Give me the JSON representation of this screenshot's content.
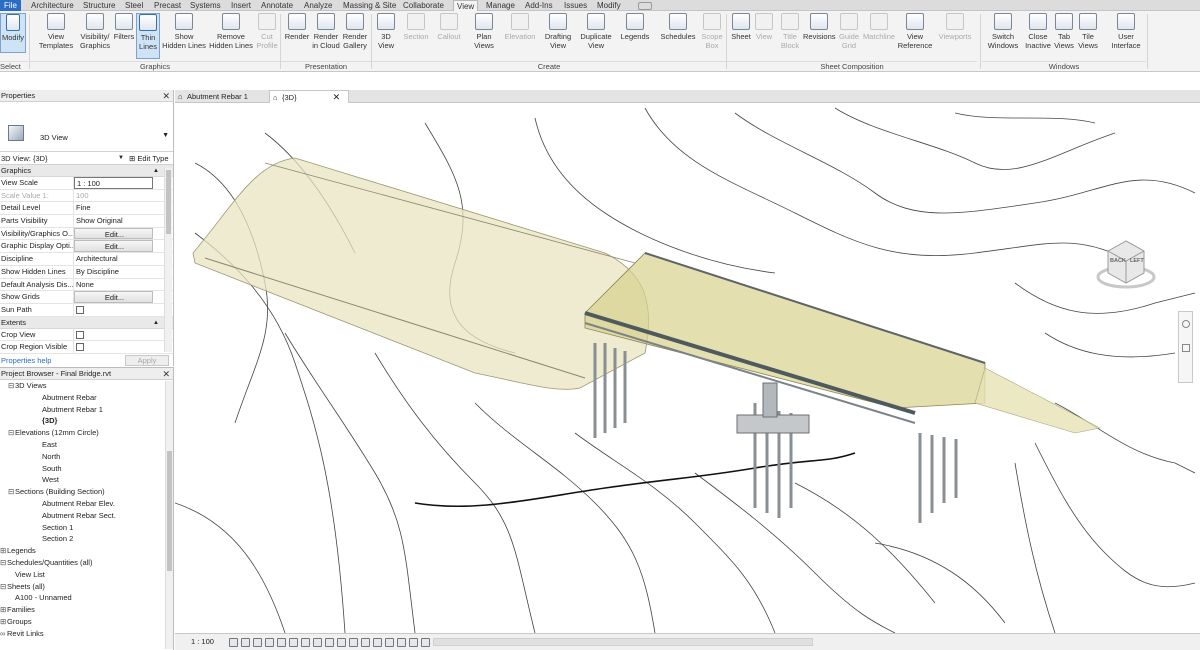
{
  "ribbon_tabs": [
    "File",
    "Architecture",
    "Structure",
    "Steel",
    "Precast",
    "Systems",
    "Insert",
    "Annotate",
    "Analyze",
    "Massing & Site",
    "Collaborate",
    "View",
    "Manage",
    "Add-Ins",
    "Issues",
    "Modify"
  ],
  "active_tab": "View",
  "modify": {
    "label": "Modify",
    "select_label": "Select"
  },
  "graphics_group": {
    "label": "Graphics",
    "buttons": [
      "View Templates",
      "Visibility/ Graphics",
      "Filters",
      "Thin Lines",
      "Show Hidden Lines",
      "Remove Hidden Lines",
      "Cut Profile"
    ]
  },
  "presentation_group": {
    "label": "Presentation",
    "buttons": [
      "Render",
      "Render in Cloud",
      "Render Gallery"
    ]
  },
  "create_group": {
    "label": "Create",
    "buttons": [
      "3D View",
      "Section",
      "Callout",
      "Plan Views",
      "Elevation",
      "Drafting View",
      "Duplicate View",
      "Legends",
      "Schedules",
      "Scope Box"
    ]
  },
  "sheet_group": {
    "label": "Sheet Composition",
    "buttons": [
      "Sheet",
      "View",
      "Title Block",
      "Revisions",
      "Guide Grid",
      "Matchline",
      "View Reference",
      "Viewports"
    ]
  },
  "windows_group": {
    "label": "Windows",
    "buttons": [
      "Switch Windows",
      "Close Inactive",
      "Tab Views",
      "Tile Views",
      "User Interface"
    ]
  },
  "properties": {
    "title": "Properties",
    "type_name": "3D View",
    "instance_filter": "3D View: {3D}",
    "edit_type": "Edit Type",
    "category_graphics": "Graphics",
    "rows": [
      {
        "k": "View Scale",
        "v": "1 : 100",
        "style": "box"
      },
      {
        "k": "Scale Value  1:",
        "v": "100",
        "style": "dis"
      },
      {
        "k": "Detail Level",
        "v": "Fine"
      },
      {
        "k": "Parts Visibility",
        "v": "Show Original"
      },
      {
        "k": "Visibility/Graphics O...",
        "v": "Edit...",
        "style": "btn"
      },
      {
        "k": "Graphic Display Opti...",
        "v": "Edit...",
        "style": "btn"
      },
      {
        "k": "Discipline",
        "v": "Architectural"
      },
      {
        "k": "Show Hidden Lines",
        "v": "By Discipline"
      },
      {
        "k": "Default Analysis Dis...",
        "v": "None"
      },
      {
        "k": "Show Grids",
        "v": "Edit...",
        "style": "btn"
      },
      {
        "k": "Sun Path",
        "v": "",
        "style": "check"
      }
    ],
    "category_extents": "Extents",
    "extent_rows": [
      {
        "k": "Crop View",
        "v": "",
        "style": "check"
      },
      {
        "k": "Crop Region Visible",
        "v": "",
        "style": "check"
      }
    ],
    "help": "Properties help",
    "apply": "Apply"
  },
  "project_browser": {
    "title": "Project Browser - Final Bridge.rvt",
    "nodes": [
      {
        "t": "3D Views",
        "lvl": 1,
        "tg": "⊟"
      },
      {
        "t": "Abutment Rebar",
        "lvl": 2
      },
      {
        "t": "Abutment Rebar 1",
        "lvl": 2
      },
      {
        "t": "{3D}",
        "lvl": 2,
        "bold": true
      },
      {
        "t": "Elevations (12mm Circle)",
        "lvl": 1,
        "tg": "⊟"
      },
      {
        "t": "East",
        "lvl": 2
      },
      {
        "t": "North",
        "lvl": 2
      },
      {
        "t": "South",
        "lvl": 2
      },
      {
        "t": "West",
        "lvl": 2
      },
      {
        "t": "Sections (Building Section)",
        "lvl": 1,
        "tg": "⊟"
      },
      {
        "t": "Abutment Rebar Elev.",
        "lvl": 2
      },
      {
        "t": "Abutment Rebar Sect.",
        "lvl": 2
      },
      {
        "t": "Section 1",
        "lvl": 2
      },
      {
        "t": "Section 2",
        "lvl": 2
      },
      {
        "t": "Legends",
        "lvl": 0,
        "tg": "⊞"
      },
      {
        "t": "Schedules/Quantities (all)",
        "lvl": 0,
        "tg": "⊟"
      },
      {
        "t": "View List",
        "lvl": 1
      },
      {
        "t": "Sheets (all)",
        "lvl": 0,
        "tg": "⊟"
      },
      {
        "t": "A100 - Unnamed",
        "lvl": 1
      },
      {
        "t": "Families",
        "lvl": 0,
        "tg": "⊞"
      },
      {
        "t": "Groups",
        "lvl": 0,
        "tg": "⊞"
      },
      {
        "t": "Revit Links",
        "lvl": 0,
        "tg": "∞"
      }
    ]
  },
  "doc_tabs": [
    {
      "label": "Abutment Rebar 1",
      "active": false
    },
    {
      "label": "{3D}",
      "active": true
    }
  ],
  "status": {
    "scale": "1 : 100"
  },
  "viewcube": {
    "back": "BACK",
    "left": "LEFT"
  },
  "colors": {
    "ribbon_bg": "#f3f3f3",
    "file_tab": "#2b6cc4",
    "selection_blue": "#cfe3f7",
    "deck_yellow": "#c9c36a"
  }
}
